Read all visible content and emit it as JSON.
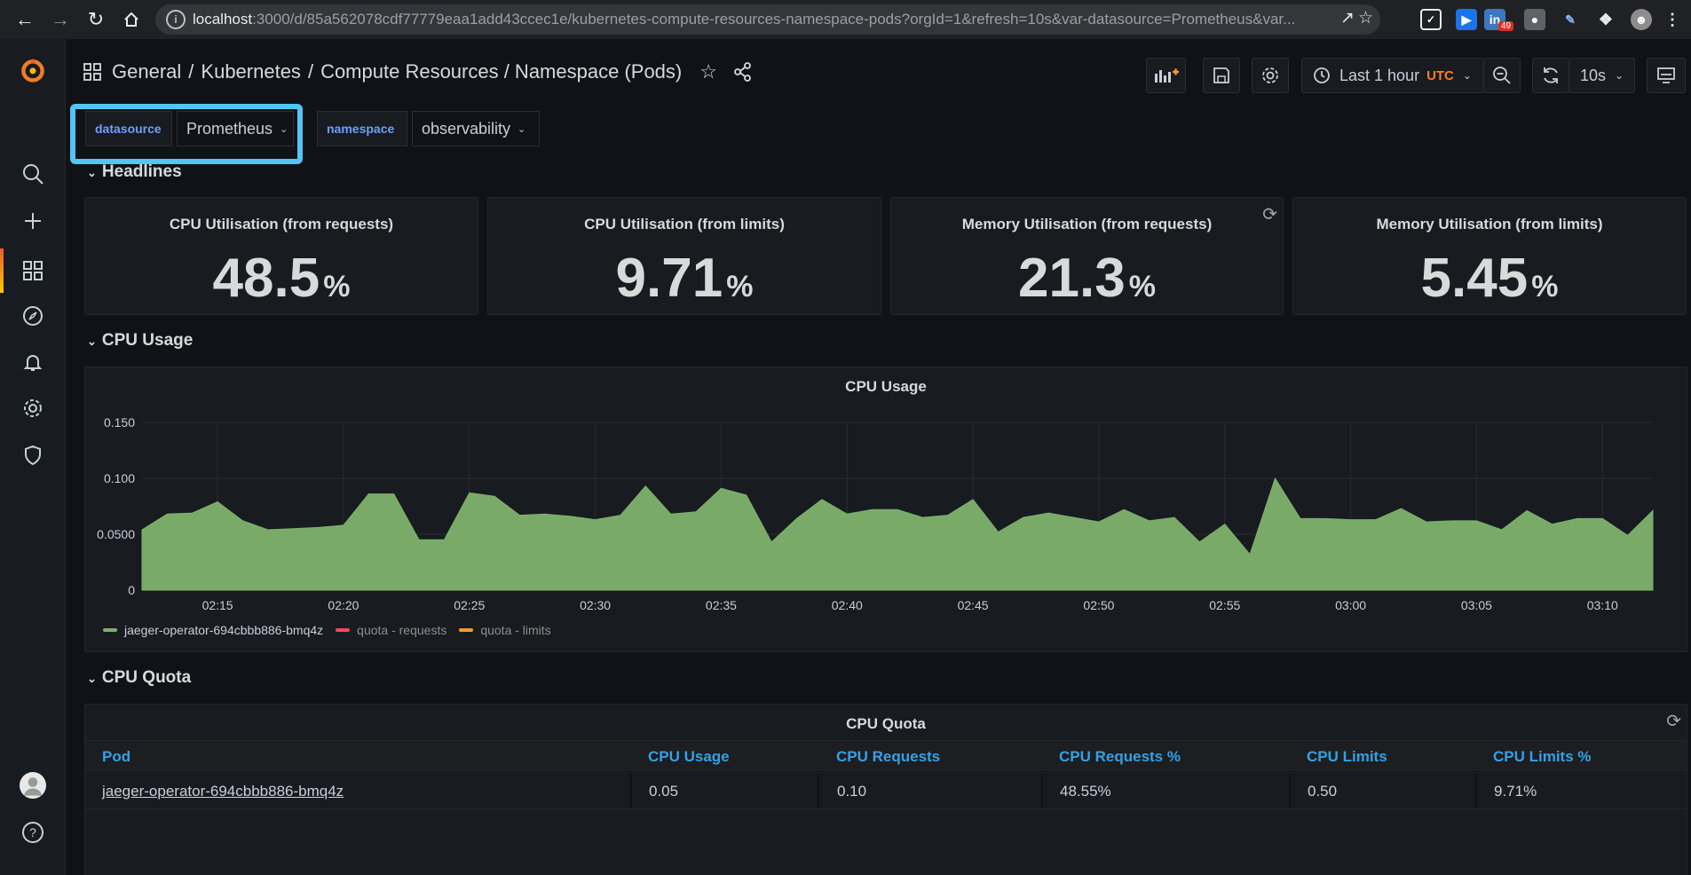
{
  "browser": {
    "url_host": "localhost",
    "url_rest": ":3000/d/85a562078cdf77779eaa1add43ccec1e/kubernetes-compute-resources-namespace-pods?orgId=1&refresh=10s&var-datasource=Prometheus&var...",
    "ext_badge": "49"
  },
  "breadcrumb": {
    "general": "General",
    "sep1": "/",
    "kubernetes": "Kubernetes",
    "sep2": "/",
    "dashboard": "Compute Resources / Namespace (Pods)"
  },
  "toolbar": {
    "time_range": "Last 1 hour",
    "timezone": "UTC",
    "refresh": "10s"
  },
  "variables": {
    "datasource_label": "datasource",
    "datasource_value": "Prometheus",
    "namespace_label": "namespace",
    "namespace_value": "observability"
  },
  "rows": {
    "headlines": "Headlines",
    "cpu_usage": "CPU Usage",
    "cpu_quota": "CPU Quota"
  },
  "stats": [
    {
      "title": "CPU Utilisation (from requests)",
      "value": "48.5",
      "unit": "%"
    },
    {
      "title": "CPU Utilisation (from limits)",
      "value": "9.71",
      "unit": "%"
    },
    {
      "title": "Memory Utilisation (from requests)",
      "value": "21.3",
      "unit": "%"
    },
    {
      "title": "Memory Utilisation (from limits)",
      "value": "5.45",
      "unit": "%"
    }
  ],
  "chart_data": {
    "type": "area",
    "title": "CPU Usage",
    "yticks": [
      "0.150",
      "0.100",
      "0.0500",
      "0"
    ],
    "xticks": [
      "02:15",
      "02:20",
      "02:25",
      "02:30",
      "02:35",
      "02:40",
      "02:45",
      "02:50",
      "02:55",
      "03:00",
      "03:05",
      "03:10"
    ],
    "ylim": [
      0,
      0.15
    ],
    "x_start": "02:12",
    "x_end": "03:12",
    "series": [
      {
        "name": "jaeger-operator-694cbbb886-bmq4z",
        "color": "#7eb26d",
        "values": [
          0.054,
          0.068,
          0.069,
          0.079,
          0.062,
          0.054,
          0.055,
          0.056,
          0.058,
          0.086,
          0.086,
          0.045,
          0.045,
          0.087,
          0.084,
          0.067,
          0.068,
          0.066,
          0.063,
          0.067,
          0.093,
          0.068,
          0.07,
          0.091,
          0.085,
          0.043,
          0.064,
          0.081,
          0.068,
          0.072,
          0.072,
          0.065,
          0.067,
          0.081,
          0.052,
          0.065,
          0.069,
          0.065,
          0.061,
          0.072,
          0.062,
          0.065,
          0.043,
          0.059,
          0.032,
          0.1,
          0.064,
          0.064,
          0.063,
          0.063,
          0.073,
          0.061,
          0.062,
          0.062,
          0.054,
          0.071,
          0.059,
          0.064,
          0.064,
          0.049,
          0.071
        ]
      },
      {
        "name": "quota - requests",
        "color": "#f2495c"
      },
      {
        "name": "quota - limits",
        "color": "#ff9830"
      }
    ]
  },
  "table": {
    "title": "CPU Quota",
    "headers": [
      "Pod",
      "CPU Usage",
      "CPU Requests",
      "CPU Requests %",
      "CPU Limits",
      "CPU Limits %"
    ],
    "rows": [
      [
        "jaeger-operator-694cbbb886-bmq4z",
        "0.05",
        "0.10",
        "48.55%",
        "0.50",
        "9.71%"
      ]
    ]
  }
}
